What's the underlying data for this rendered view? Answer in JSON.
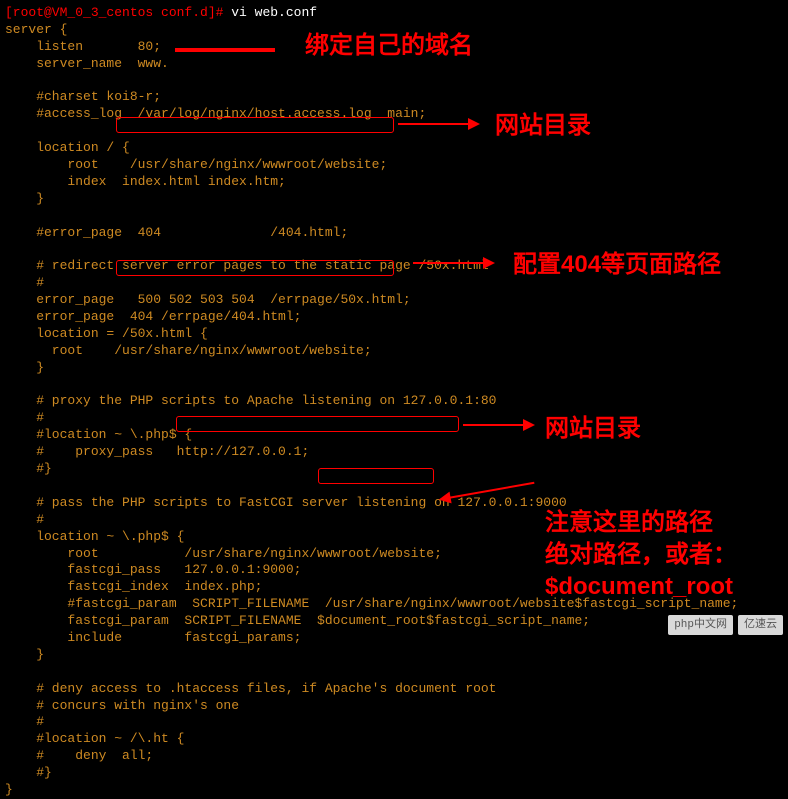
{
  "prompt": "[root@VM_0_3_centos conf.d]# ",
  "command": "vi web.conf",
  "annotations": {
    "bind_domain": "绑定自己的域名",
    "web_dir1": "网站目录",
    "error_path": "配置404等页面路径",
    "web_dir2": "网站目录",
    "path_note1": "注意这里的路径",
    "path_note2": "绝对路径，或者：",
    "path_note3": "$document_root"
  },
  "config": {
    "l1": "server {",
    "l2": "    listen       80;",
    "l3": "    server_name  www.",
    "l4": "",
    "l5": "    #charset koi8-r;",
    "l6": "    #access_log  /var/log/nginx/host.access.log  main;",
    "l7": "",
    "l8": "    location / {",
    "l9": "        root    /usr/share/nginx/wwwroot/website;",
    "l10": "        index  index.html index.htm;",
    "l11": "    }",
    "l12": "",
    "l13": "    #error_page  404              /404.html;",
    "l14": "",
    "l15": "    # redirect server error pages to the static page /50x.html",
    "l16": "    #",
    "l17": "    error_page   500 502 503 504  /errpage/50x.html;",
    "l18": "    error_page  404 /errpage/404.html;",
    "l19": "    location = /50x.html {",
    "l20": "      root    /usr/share/nginx/wwwroot/website;",
    "l21": "    }",
    "l22": "",
    "l23": "    # proxy the PHP scripts to Apache listening on 127.0.0.1:80",
    "l24": "    #",
    "l25": "    #location ~ \\.php$ {",
    "l26": "    #    proxy_pass   http://127.0.0.1;",
    "l27": "    #}",
    "l28": "",
    "l29": "    # pass the PHP scripts to FastCGI server listening on 127.0.0.1:9000",
    "l30": "    #",
    "l31": "    location ~ \\.php$ {",
    "l32": "        root           /usr/share/nginx/wwwroot/website;",
    "l33": "        fastcgi_pass   127.0.0.1:9000;",
    "l34": "        fastcgi_index  index.php;",
    "l35": "        #fastcgi_param  SCRIPT_FILENAME  /usr/share/nginx/wwwroot/website$fastcgi_script_name;",
    "l36": "        fastcgi_param  SCRIPT_FILENAME  $document_root$fastcgi_script_name;",
    "l37": "        include        fastcgi_params;",
    "l38": "    }",
    "l39": "",
    "l40": "    # deny access to .htaccess files, if Apache's document root",
    "l41": "    # concurs with nginx's one",
    "l42": "    #",
    "l43": "    #location ~ /\\.ht {",
    "l44": "    #    deny  all;",
    "l45": "    #}",
    "l46": "}"
  },
  "logos": {
    "phpcn": "php中文网",
    "yiyun": "亿速云"
  }
}
